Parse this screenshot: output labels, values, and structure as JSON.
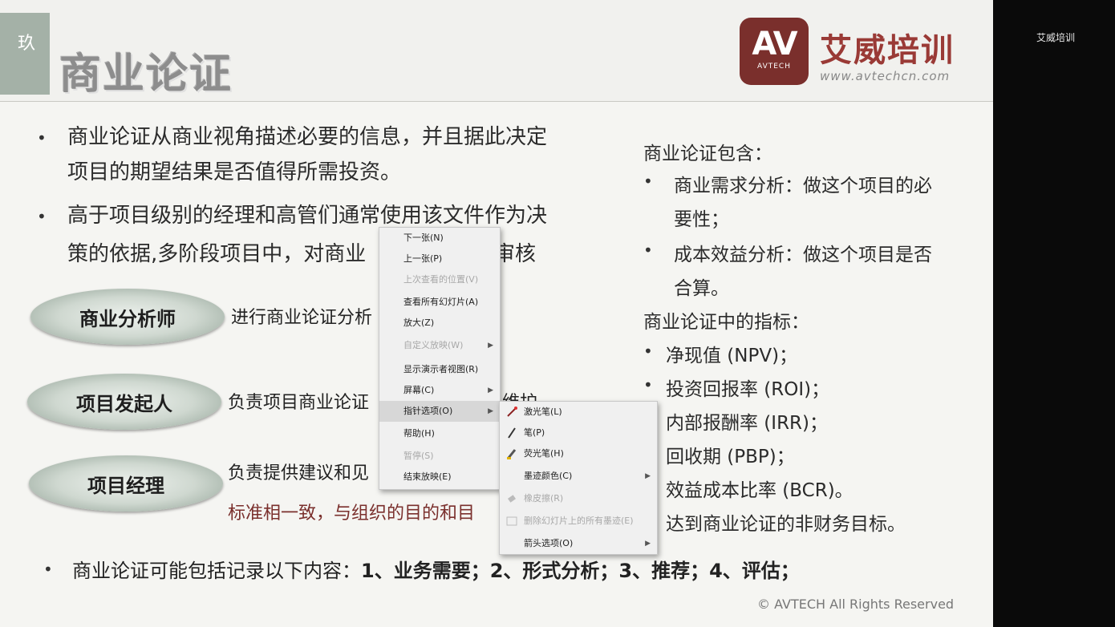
{
  "sidebar": {
    "brand": "艾威培训"
  },
  "header": {
    "tab_label": "玖",
    "title": "商业论证",
    "logo": {
      "mark": "AV",
      "mark_sub": "AVTECH",
      "name": "艾威培训",
      "url": "www.avtechcn.com"
    }
  },
  "main": {
    "bullet1_line1": "商业论证从商业视角描述必要的信息，并且据此决定",
    "bullet1_line2": "项目的期望结果是否值得所需投资。",
    "bullet2_line1": "高于项目级别的经理和高管们通常使用该文件作为决",
    "bullet2_line2a": "策的依据,多阶段项目中，对商业",
    "bullet2_line2b": "审核",
    "roles": [
      {
        "label": "商业分析师",
        "desc": "进行商业论证分析"
      },
      {
        "label": "项目发起人",
        "desc": "负责项目商业论证",
        "desc_tail": "维护"
      },
      {
        "label": "项目经理",
        "desc": "负责提供建议和见",
        "desc2": "标准相一致，与组织的目的和目"
      }
    ]
  },
  "right": {
    "heading1": "商业论证包含：",
    "item1_line1": "商业需求分析：做这个项目的必",
    "item1_line2": "要性；",
    "item2_line1": "成本效益分析：做这个项目是否",
    "item2_line2": "合算。",
    "heading2": "商业论证中的指标：",
    "metrics": [
      "净现值 (NPV)；",
      "投资回报率 (ROI)；",
      "内部报酬率 (IRR)；",
      "回收期 (PBP)；",
      "效益成本比率 (BCR)。",
      "达到商业论证的非财务目标。"
    ]
  },
  "bottom": {
    "prefix": "商业论证可能包括记录以下内容：",
    "items": "1、业务需要；2、形式分析；3、推荐；4、评估；"
  },
  "copyright": "© AVTECH All Rights Reserved",
  "context_menu": {
    "items": [
      {
        "label": "下一张(N)",
        "disabled": false
      },
      {
        "label": "上一张(P)",
        "disabled": false
      },
      {
        "label": "上次查看的位置(V)",
        "disabled": true
      },
      {
        "label": "查看所有幻灯片(A)",
        "disabled": false
      },
      {
        "label": "放大(Z)",
        "disabled": false
      },
      {
        "label": "自定义放映(W)",
        "disabled": true
      },
      {
        "label": "显示演示者视图(R)",
        "disabled": false
      },
      {
        "label": "屏幕(C)",
        "disabled": false
      },
      {
        "label": "指针选项(O)",
        "disabled": false
      },
      {
        "label": "帮助(H)",
        "disabled": false
      },
      {
        "label": "暂停(S)",
        "disabled": true
      },
      {
        "label": "结束放映(E)",
        "disabled": false
      }
    ]
  },
  "submenu": {
    "items": [
      {
        "label": "激光笔(L)",
        "disabled": false,
        "icon": "laser-pointer-icon"
      },
      {
        "label": "笔(P)",
        "disabled": false,
        "icon": "pen-icon"
      },
      {
        "label": "荧光笔(H)",
        "disabled": false,
        "icon": "highlighter-icon"
      },
      {
        "label": "墨迹颜色(C)",
        "disabled": false,
        "icon": ""
      },
      {
        "label": "橡皮擦(R)",
        "disabled": true,
        "icon": "eraser-icon"
      },
      {
        "label": "删除幻灯片上的所有墨迹(E)",
        "disabled": true,
        "icon": "erase-all-icon"
      },
      {
        "label": "箭头选项(O)",
        "disabled": false,
        "icon": ""
      }
    ]
  }
}
